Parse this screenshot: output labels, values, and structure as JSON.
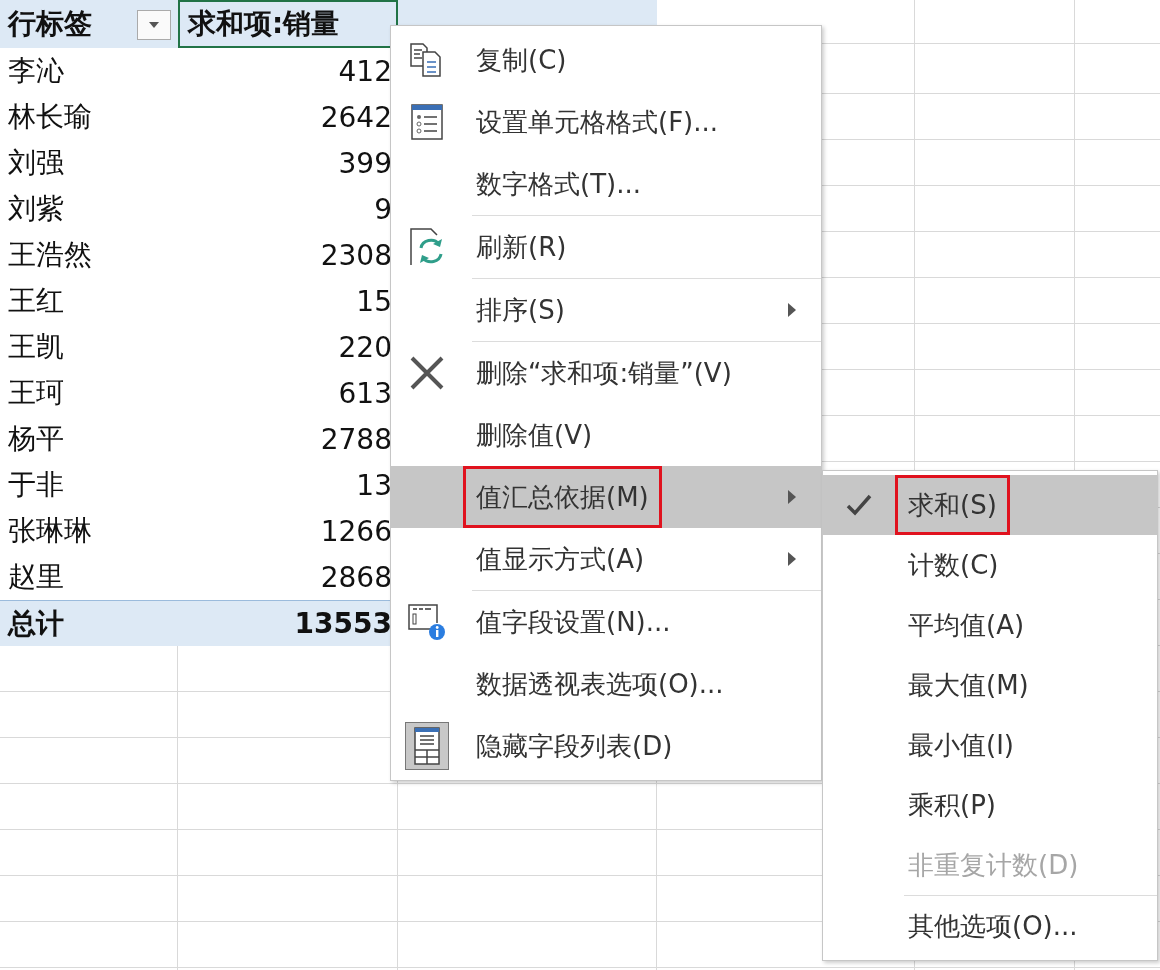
{
  "pivot": {
    "row_header": "行标签",
    "value_header": "求和项:销量",
    "rows": [
      {
        "name": "李沁",
        "value": "412"
      },
      {
        "name": "林长瑜",
        "value": "2642"
      },
      {
        "name": "刘强",
        "value": "399"
      },
      {
        "name": "刘紫",
        "value": "9"
      },
      {
        "name": "王浩然",
        "value": "2308"
      },
      {
        "name": "王红",
        "value": "15"
      },
      {
        "name": "王凯",
        "value": "220"
      },
      {
        "name": "王珂",
        "value": "613"
      },
      {
        "name": "杨平",
        "value": "2788"
      },
      {
        "name": "于非",
        "value": "13"
      },
      {
        "name": "张琳琳",
        "value": "1266"
      },
      {
        "name": "赵里",
        "value": "2868"
      }
    ],
    "total": {
      "label": "总计",
      "value": "13553"
    }
  },
  "context_menu": [
    {
      "label": "复制(C)",
      "kind": "copy",
      "submenu": false,
      "highlighted": false,
      "boxed": false,
      "separator_after": false
    },
    {
      "label": "设置单元格格式(F)...",
      "kind": "format",
      "submenu": false,
      "highlighted": false,
      "boxed": false,
      "separator_after": false
    },
    {
      "label": "数字格式(T)...",
      "kind": "plain",
      "submenu": false,
      "highlighted": false,
      "boxed": false,
      "separator_after": true
    },
    {
      "label": "刷新(R)",
      "kind": "refresh",
      "submenu": false,
      "highlighted": false,
      "boxed": false,
      "separator_after": true
    },
    {
      "label": "排序(S)",
      "kind": "plain",
      "submenu": true,
      "highlighted": false,
      "boxed": false,
      "separator_after": true
    },
    {
      "label": "删除“求和项:销量”(V)",
      "kind": "delete",
      "submenu": false,
      "highlighted": false,
      "boxed": false,
      "separator_after": false
    },
    {
      "label": "删除值(V)",
      "kind": "plain",
      "submenu": false,
      "highlighted": false,
      "boxed": false,
      "separator_after": false
    },
    {
      "label": "值汇总依据(M)",
      "kind": "plain",
      "submenu": true,
      "highlighted": true,
      "boxed": true,
      "separator_after": false
    },
    {
      "label": "值显示方式(A)",
      "kind": "plain",
      "submenu": true,
      "highlighted": false,
      "boxed": false,
      "separator_after": true
    },
    {
      "label": "值字段设置(N)...",
      "kind": "field-settings",
      "submenu": false,
      "highlighted": false,
      "boxed": false,
      "separator_after": false
    },
    {
      "label": "数据透视表选项(O)...",
      "kind": "plain",
      "submenu": false,
      "highlighted": false,
      "boxed": false,
      "separator_after": false
    },
    {
      "label": "隐藏字段列表(D)",
      "kind": "field-list",
      "submenu": false,
      "highlighted": false,
      "boxed": false,
      "separator_after": false
    }
  ],
  "submenu": [
    {
      "label": "求和(S)",
      "checked": true,
      "highlighted": true,
      "boxed": true,
      "disabled": false,
      "separator_after": false
    },
    {
      "label": "计数(C)",
      "checked": false,
      "highlighted": false,
      "boxed": false,
      "disabled": false,
      "separator_after": false
    },
    {
      "label": "平均值(A)",
      "checked": false,
      "highlighted": false,
      "boxed": false,
      "disabled": false,
      "separator_after": false
    },
    {
      "label": "最大值(M)",
      "checked": false,
      "highlighted": false,
      "boxed": false,
      "disabled": false,
      "separator_after": false
    },
    {
      "label": "最小值(I)",
      "checked": false,
      "highlighted": false,
      "boxed": false,
      "disabled": false,
      "separator_after": false
    },
    {
      "label": "乘积(P)",
      "checked": false,
      "highlighted": false,
      "boxed": false,
      "disabled": false,
      "separator_after": false
    },
    {
      "label": "非重复计数(D)",
      "checked": false,
      "highlighted": false,
      "boxed": false,
      "disabled": true,
      "separator_after": true
    },
    {
      "label": "其他选项(O)...",
      "checked": false,
      "highlighted": false,
      "boxed": false,
      "disabled": false,
      "separator_after": false
    }
  ]
}
